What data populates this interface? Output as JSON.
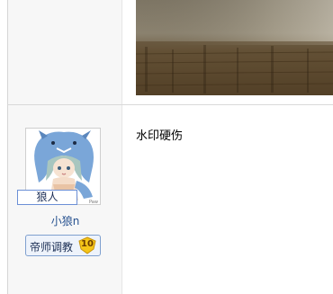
{
  "post": {
    "body_text": "水印硬伤"
  },
  "author": {
    "avatar_tag": "狼人",
    "username": "小狼n",
    "rank": {
      "title": "帝师调教",
      "level": "10",
      "badge_color": "#f5c518"
    },
    "avatar_icon": "wolf-girl-avatar-icon"
  },
  "colors": {
    "sidebar_bg": "#f7f7f7",
    "username_color": "#25508f",
    "badge_border": "#7fa0cf"
  }
}
